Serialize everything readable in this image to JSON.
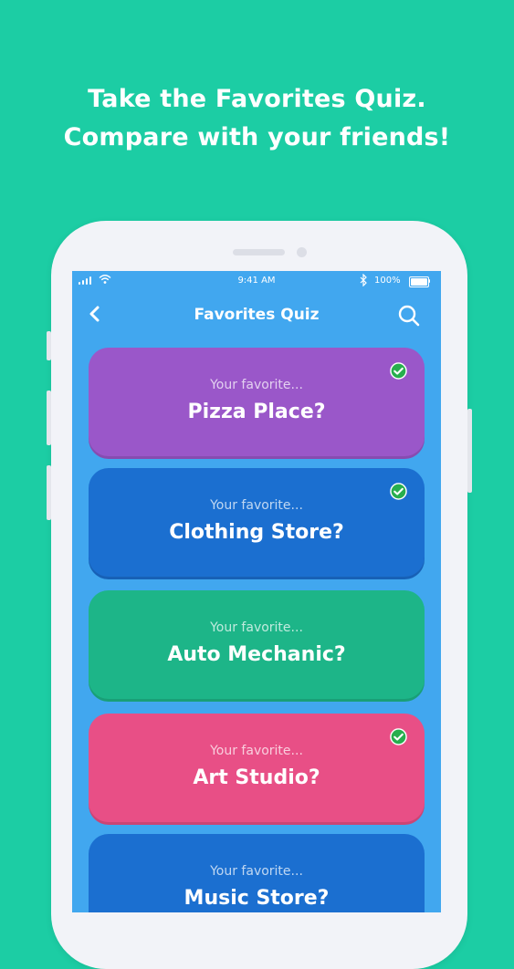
{
  "headline": {
    "line1": "Take the Favorites Quiz.",
    "line2": "Compare with your friends!"
  },
  "status_bar": {
    "time": "9:41 AM",
    "battery": "100%"
  },
  "nav": {
    "title": "Favorites Quiz",
    "back_icon": "chevron-left-icon",
    "search_icon": "search-icon"
  },
  "colors": {
    "background": "#1ccda4",
    "screen": "#41a7ef",
    "check": "#27ae4e"
  },
  "cards": [
    {
      "subtitle": "Your favorite...",
      "title": "Pizza Place?",
      "color": "#9a57c9",
      "completed": true
    },
    {
      "subtitle": "Your favorite...",
      "title": "Clothing Store?",
      "color": "#1b6fd0",
      "completed": true
    },
    {
      "subtitle": "Your favorite...",
      "title": "Auto Mechanic?",
      "color": "#1db588",
      "completed": false
    },
    {
      "subtitle": "Your favorite...",
      "title": "Art Studio?",
      "color": "#e84f86",
      "completed": true
    },
    {
      "subtitle": "Your favorite...",
      "title": "Music Store?",
      "color": "#1b6fd0",
      "completed": false
    }
  ]
}
